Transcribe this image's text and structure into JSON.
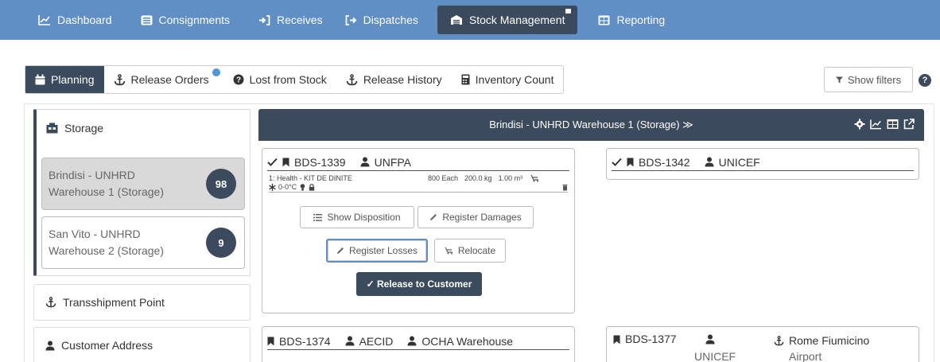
{
  "nav": {
    "items": [
      {
        "label": "Dashboard",
        "icon": "line-chart-icon"
      },
      {
        "label": "Consignments",
        "icon": "list-icon"
      },
      {
        "label": "Receives",
        "icon": "sign-in-icon"
      },
      {
        "label": "Dispatches",
        "icon": "sign-out-icon"
      },
      {
        "label": "Stock Management",
        "icon": "warehouse-icon"
      },
      {
        "label": "Reporting",
        "icon": "table-icon"
      }
    ],
    "active": "Stock Management"
  },
  "subtabs": {
    "items": [
      {
        "label": "Planning"
      },
      {
        "label": "Release Orders"
      },
      {
        "label": "Lost from Stock"
      },
      {
        "label": "Release History"
      },
      {
        "label": "Inventory Count"
      }
    ],
    "active": "Planning",
    "show_filters": "Show filters",
    "help": "?"
  },
  "sidebar": {
    "storage_label": "Storage",
    "warehouses": [
      {
        "name_line1": "Brindisi - UNHRD",
        "name_line2": "Warehouse 1 (Storage)",
        "count": "98",
        "selected": true
      },
      {
        "name_line1": "San Vito - UNHRD",
        "name_line2": "Warehouse 2 (Storage)",
        "count": "9",
        "selected": false
      }
    ],
    "transshipment_label": "Transshipment Point",
    "customer_label": "Customer Address"
  },
  "location": {
    "title": "Brindisi - UNHRD Warehouse 1 (Storage) ≫"
  },
  "cards": {
    "c1": {
      "id": "BDS-1339",
      "owner": "UNFPA",
      "item": "1: Health - KIT DE DINITE",
      "qty": "800 Each",
      "weight": "200.0 kg",
      "volume": "1.00 m³",
      "temp": "0-0°C",
      "buttons": {
        "show_disposition": "Show Disposition",
        "register_damages": "Register Damages",
        "register_losses": "Register Losses",
        "relocate": "Relocate",
        "release": "✓ Release to Customer"
      }
    },
    "c2": {
      "id": "BDS-1342",
      "owner": "UNICEF"
    },
    "c3": {
      "id": "BDS-1374",
      "owner": "AECID",
      "destination": "OCHA Warehouse"
    },
    "c4": {
      "id": "BDS-1377",
      "owner_line2": "UNICEF",
      "destination_line1": "Rome Fiumicino",
      "destination_line2": "Airport"
    }
  },
  "colors": {
    "nav_bg": "#5f8fc4",
    "dark": "#3b4a5c",
    "badge": "#4e95d8"
  }
}
